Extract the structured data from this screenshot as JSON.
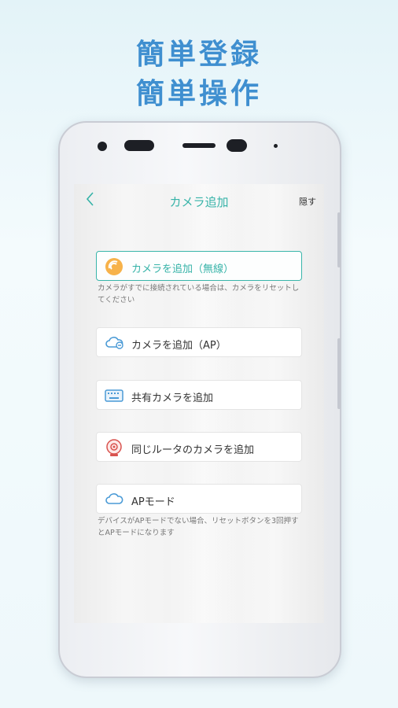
{
  "promo": {
    "line1": "簡単登録",
    "line2": "簡単操作"
  },
  "nav": {
    "back_icon": "chevron-left-icon",
    "title": "カメラ追加",
    "hide": "隠す"
  },
  "options": [
    {
      "label": "カメラを追加（無線）",
      "icon": "wireless-icon",
      "selected": true
    },
    {
      "label": "カメラを追加（AP）",
      "icon": "cloud-link-icon"
    },
    {
      "label": "共有カメラを追加",
      "icon": "keyboard-icon"
    },
    {
      "label": "同じルータのカメラを追加",
      "icon": "router-icon"
    },
    {
      "label": "APモード",
      "icon": "cloud-icon"
    }
  ],
  "hints": {
    "wireless": "カメラがすでに接続されている場合は、カメラをリセットしてください",
    "ap_mode": "デバイスがAPモードでない場合、リセットボタンを3回押すとAPモードになります"
  },
  "colors": {
    "accent": "#36b3a8",
    "headline": "#3f8fd0",
    "icon_blue": "#4a9ad6",
    "icon_red": "#d9534f"
  }
}
